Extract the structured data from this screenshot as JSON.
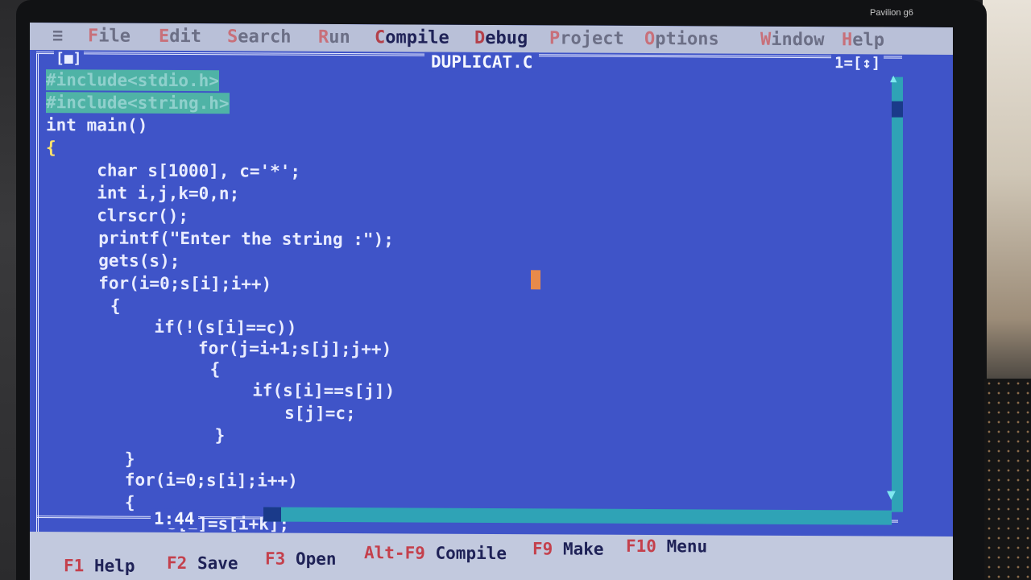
{
  "device": {
    "brand": "Pavilion g6"
  },
  "menubar": {
    "system": "≡",
    "items": [
      "File",
      "Edit",
      "Search",
      "Run",
      "Compile",
      "Debug",
      "Project",
      "Options",
      "Window",
      "Help"
    ]
  },
  "window": {
    "close": "[■]",
    "title": "DUPLICAT.C",
    "number": "1=[↕]"
  },
  "editor": {
    "lines": [
      "#include<stdio.h>",
      "#include<string.h>",
      "int main()",
      "{",
      "     char s[1000], c='*';",
      "     int i,j,k=0,n;",
      "     clrscr();",
      "     printf(\"Enter the string :\");",
      "     gets(s);",
      "     for(i=0;s[i];i++)",
      "      {",
      "          if(!(s[i]==c))",
      "              for(j=i+1;s[j];j++)",
      "               {",
      "                   if(s[i]==s[j])",
      "                      s[j]=c;",
      "               }",
      "      }",
      "      for(i=0;s[i];i++)",
      "      {",
      "          s[i]=s[i+k];"
    ]
  },
  "status": {
    "position": "1:44"
  },
  "function_keys": [
    {
      "key": "F1",
      "label": "Help"
    },
    {
      "key": "F2",
      "label": "Save"
    },
    {
      "key": "F3",
      "label": "Open"
    },
    {
      "key": "Alt-F9",
      "label": "Compile"
    },
    {
      "key": "F9",
      "label": "Make"
    },
    {
      "key": "F10",
      "label": "Menu"
    }
  ]
}
